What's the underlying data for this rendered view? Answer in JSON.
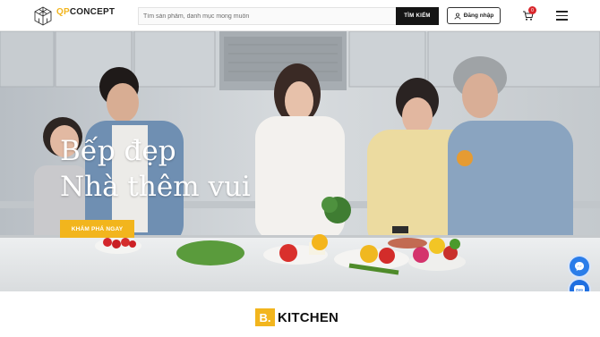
{
  "header": {
    "logo_brand_prefix": "QP",
    "logo_brand_suffix": "CONCEPT",
    "search_placeholder": "Tìm sản phẩm, danh mục mong muốn",
    "search_button": "TÌM KIẾM",
    "login_label": "Đăng nhập",
    "cart_count": "0"
  },
  "hero": {
    "title_line1": "Bếp đẹp",
    "title_line2": "Nhà thêm vui",
    "cta_label": "KHÁM PHÁ NGAY"
  },
  "section": {
    "badge_letter": "B.",
    "title": "KITCHEN"
  },
  "floating": {
    "items": [
      "messenger-icon",
      "zalo-icon",
      "chat-icon"
    ]
  },
  "colors": {
    "accent": "#f2b51d",
    "dark": "#151515",
    "badge_red": "#d9262b",
    "messenger": "#2b7de9",
    "zalo": "#1f6fe0",
    "chat": "#2db34a"
  }
}
